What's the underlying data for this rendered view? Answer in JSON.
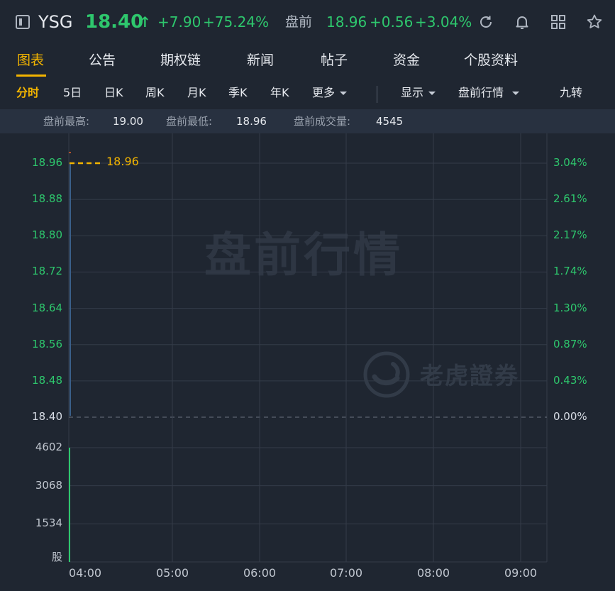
{
  "header": {
    "ticker": "YSG",
    "price": "18.40",
    "change": "+7.90",
    "change_pct": "+75.24%",
    "premarket_label": "盘前",
    "premarket_price": "18.96",
    "premarket_change": "+0.56",
    "premarket_pct": "+3.04%",
    "icons": [
      "sidebar-toggle-icon",
      "refresh-icon",
      "bell-icon",
      "grid-icon",
      "star-icon"
    ]
  },
  "tabs": [
    "图表",
    "公告",
    "期权链",
    "新闻",
    "帖子",
    "资金",
    "个股资料"
  ],
  "active_tab": "图表",
  "subtabs": {
    "intraday": "分时",
    "five_day": "5日",
    "daily": "日K",
    "weekly": "周K",
    "monthly": "月K",
    "quarterly": "季K",
    "yearly": "年K",
    "more": "更多",
    "display": "显示",
    "premarket": "盘前行情",
    "nine_turn": "九转"
  },
  "stats": {
    "high_label": "盘前最高:",
    "high_value": "19.00",
    "low_label": "盘前最低:",
    "low_value": "18.96",
    "volume_label": "盘前成交量:",
    "volume_value": "4545"
  },
  "chart": {
    "watermark": "盘前行情",
    "brand_watermark": "老虎證券",
    "price_tag": "18.96",
    "volume_axis_unit": "股"
  },
  "chart_data": {
    "type": "line",
    "price_axis_left": [
      "18.96",
      "18.88",
      "18.80",
      "18.72",
      "18.64",
      "18.56",
      "18.48",
      "18.40"
    ],
    "pct_axis_right": [
      "3.04%",
      "2.61%",
      "2.17%",
      "1.74%",
      "1.30%",
      "0.87%",
      "0.43%",
      "0.00%"
    ],
    "volume_axis": [
      "4602",
      "3068",
      "1534"
    ],
    "x_ticks": [
      "04:00",
      "05:00",
      "06:00",
      "07:00",
      "08:00",
      "09:00"
    ],
    "price_range": [
      18.4,
      18.96
    ],
    "volume_range": [
      0,
      4602
    ],
    "baseline_price": 18.4,
    "series": [
      {
        "x": [
          "04:00"
        ],
        "values": [
          18.96
        ]
      }
    ],
    "volume": [
      {
        "x": "04:00",
        "value": 4602
      }
    ],
    "colors": {
      "up": "#2ec76d",
      "tag": "#f2b400",
      "grid": "#343c49"
    }
  }
}
